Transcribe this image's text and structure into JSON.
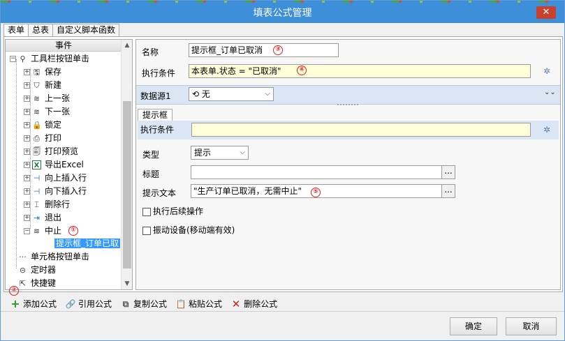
{
  "window": {
    "title": "填表公式管理",
    "close_label": "✕"
  },
  "top_tabs": [
    "表单",
    "总表",
    "自定义脚本函数"
  ],
  "tree": {
    "header": "事件",
    "root_label": "工具栏按钮单击",
    "items": [
      {
        "label": "保存",
        "icon": "save-icon",
        "glyph": "🖫"
      },
      {
        "label": "新建",
        "icon": "shield-icon",
        "glyph": "⛉"
      },
      {
        "label": "上一张",
        "icon": "layers-icon",
        "glyph": "≋"
      },
      {
        "label": "下一张",
        "icon": "layers-icon",
        "glyph": "≋"
      },
      {
        "label": "锁定",
        "icon": "lock-icon",
        "glyph": "🔒"
      },
      {
        "label": "打印",
        "icon": "printer-icon",
        "glyph": "⎙"
      },
      {
        "label": "打印预览",
        "icon": "print-preview-icon",
        "glyph": "🗐"
      },
      {
        "label": "导出Excel",
        "icon": "excel-icon",
        "glyph": "X"
      },
      {
        "label": "向上插入行",
        "icon": "insert-up-icon",
        "glyph": "⊣"
      },
      {
        "label": "向下插入行",
        "icon": "insert-down-icon",
        "glyph": "⊣"
      },
      {
        "label": "删除行",
        "icon": "delete-row-icon",
        "glyph": "⌶"
      },
      {
        "label": "退出",
        "icon": "exit-icon",
        "glyph": "⇥"
      },
      {
        "label": "中止",
        "icon": "layers-icon",
        "glyph": "≋"
      }
    ],
    "child_selected": "提示框_订单已取",
    "other_nodes": [
      {
        "label": "单元格按钮单击",
        "icon": "dots-icon",
        "glyph": "···"
      },
      {
        "label": "定时器",
        "icon": "timer-icon",
        "glyph": "⊝"
      },
      {
        "label": "快捷键",
        "icon": "shortcut-icon",
        "glyph": "⇱"
      }
    ]
  },
  "markers": [
    "①",
    "②",
    "③",
    "④",
    "⑤"
  ],
  "form": {
    "name_label": "名称",
    "name_value": "提示框_订单已取消",
    "condition_label": "执行条件",
    "condition_value": "本表单.状态 = \"已取消\"",
    "datasource_label": "数据源1",
    "datasource_value": "无",
    "sub_tab": "提示框",
    "sub_condition_label": "执行条件",
    "sub_condition_value": "",
    "type_label": "类型",
    "type_value": "提示",
    "title_label": "标题",
    "title_value": "",
    "text_label": "提示文本",
    "text_value": "\"生产订单已取消，无需中止\"",
    "ellipsis": "...",
    "check1": "执行后续操作",
    "check2": "振动设备(移动端有效)"
  },
  "toolbar": {
    "add": "添加公式",
    "ref": "引用公式",
    "copy": "复制公式",
    "paste": "粘贴公式",
    "delete": "删除公式"
  },
  "buttons": {
    "ok": "确定",
    "cancel": "取消"
  }
}
